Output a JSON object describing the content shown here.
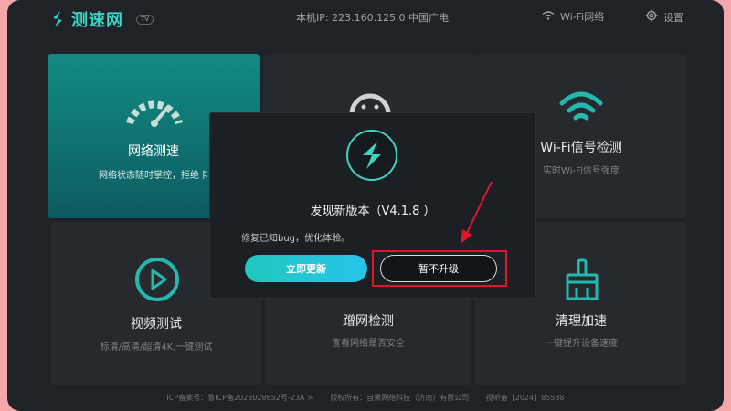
{
  "header": {
    "app_name": "测速网",
    "tv_badge": "TV",
    "ip_text": "本机IP: 223.160.125.0  中国广电",
    "wifi_label": "Wi-Fi网络",
    "settings_label": "设置"
  },
  "tiles": {
    "speed": {
      "title": "网络测速",
      "subtitle": "网络状态随时掌控，拒绝卡"
    },
    "wifi": {
      "title": "Wi-Fi信号检测",
      "subtitle": "实时Wi-Fi信号强度"
    },
    "video": {
      "title": "视频测试",
      "subtitle": "标清/高清/超清4K,一键测试"
    },
    "leak": {
      "title": "蹭网检测",
      "subtitle": "查看网络是否安全"
    },
    "clean": {
      "title": "清理加速",
      "subtitle": "一键提升设备速度"
    }
  },
  "footer": {
    "icp": "ICP备案号：鲁ICP备2023028652号-23A >",
    "copyright": "版权所有：自果网络科技（济南）有限公司",
    "license": "视听备【2024】85588"
  },
  "dialog": {
    "title": "发现新版本（V4.1.8 ）",
    "description": "修复已知bug，优化体验。",
    "update_button": "立即更新",
    "skip_button": "暂不升级"
  },
  "colors": {
    "accent": "#3ad4c8",
    "annotation": "#e0162e",
    "background": "#1f2226"
  }
}
